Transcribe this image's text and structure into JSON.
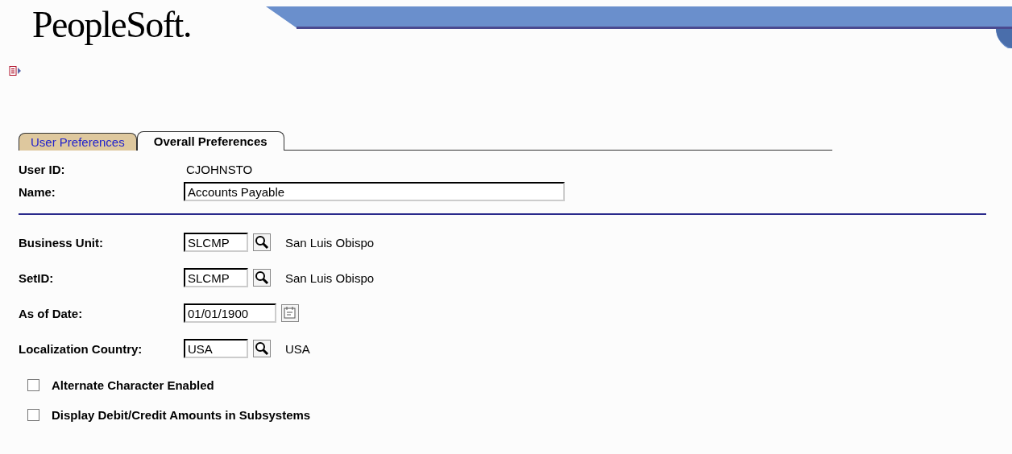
{
  "header": {
    "logo": "PeopleSoft."
  },
  "tabs": [
    {
      "label": "User Preferences",
      "selected": false
    },
    {
      "label": "Overall Preferences",
      "selected": true
    }
  ],
  "user_id": {
    "label": "User ID:",
    "value": "CJOHNSTO"
  },
  "name": {
    "label": "Name:",
    "value": "Accounts Payable"
  },
  "fields": [
    {
      "kind": "lookup",
      "label": "Business Unit:",
      "value": "SLCMP",
      "description": "San Luis Obispo"
    },
    {
      "kind": "lookup",
      "label": "SetID:",
      "value": "SLCMP",
      "description": "San Luis Obispo"
    },
    {
      "kind": "date",
      "label": "As of Date:",
      "value": "01/01/1900"
    },
    {
      "kind": "lookup",
      "label": "Localization Country:",
      "value": "USA",
      "description": "USA"
    }
  ],
  "checkboxes": [
    {
      "label": "Alternate Character Enabled",
      "checked": false
    },
    {
      "label": "Display Debit/Credit Amounts in Subsystems",
      "checked": false
    }
  ]
}
